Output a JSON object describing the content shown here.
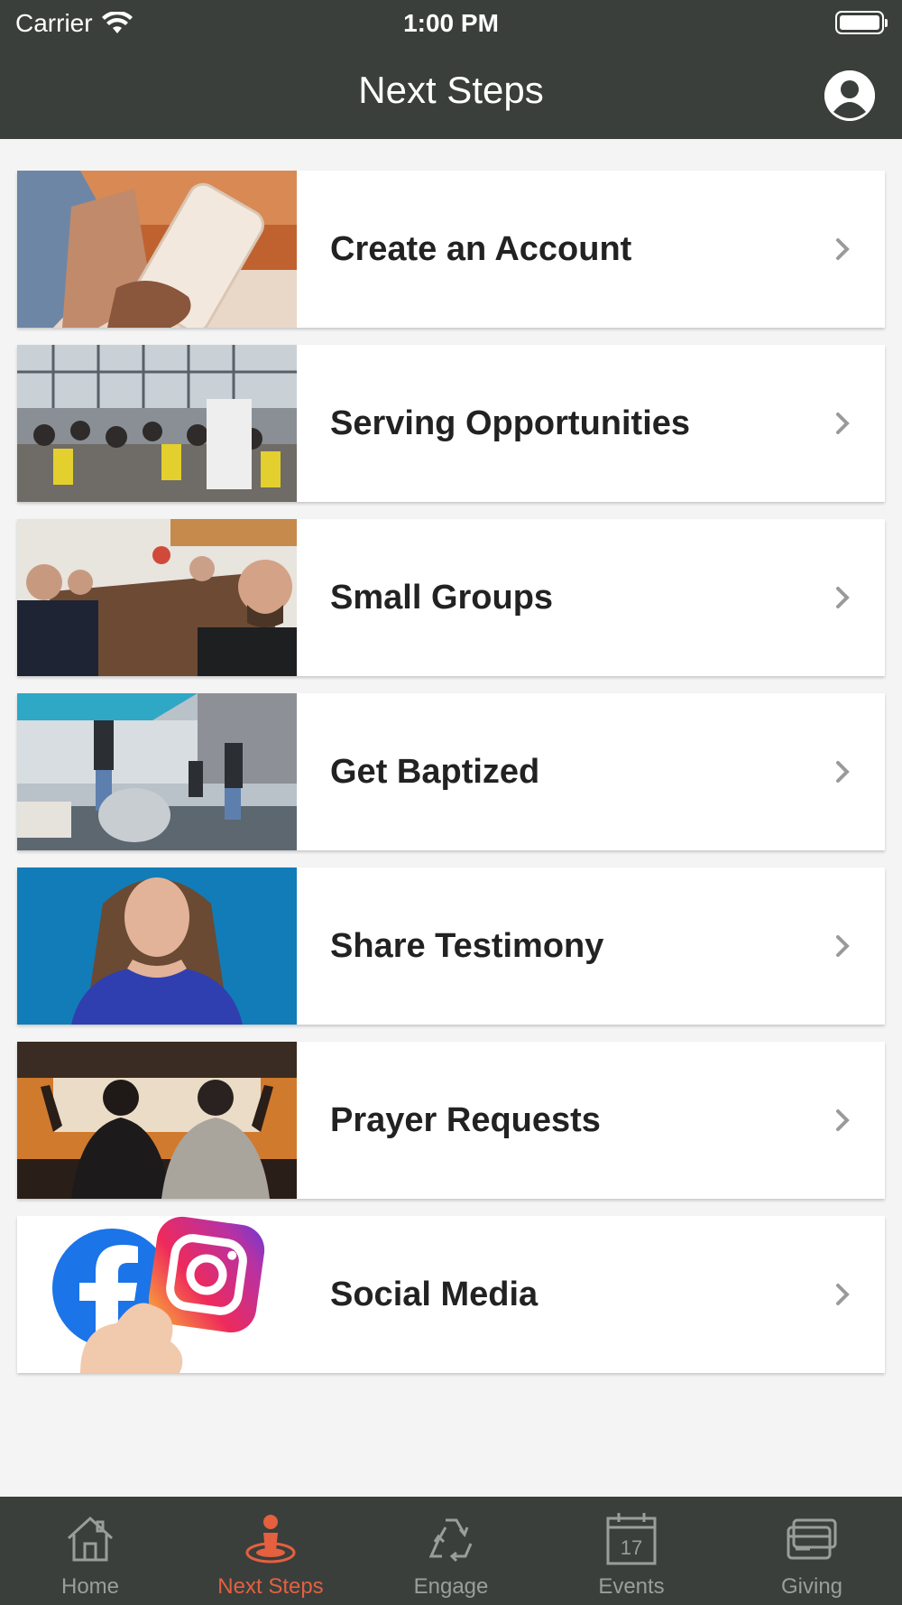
{
  "status_bar": {
    "carrier": "Carrier",
    "time": "1:00 PM"
  },
  "nav": {
    "title": "Next Steps"
  },
  "items": [
    {
      "label": "Create an Account"
    },
    {
      "label": "Serving Opportunities"
    },
    {
      "label": "Small Groups"
    },
    {
      "label": "Get Baptized"
    },
    {
      "label": "Share Testimony"
    },
    {
      "label": "Prayer Requests"
    },
    {
      "label": "Social Media"
    }
  ],
  "tabs": [
    {
      "label": "Home",
      "icon": "home-icon"
    },
    {
      "label": "Next Steps",
      "icon": "next-steps-icon",
      "active": true
    },
    {
      "label": "Engage",
      "icon": "recycle-icon"
    },
    {
      "label": "Events",
      "icon": "calendar-icon",
      "day": "17"
    },
    {
      "label": "Giving",
      "icon": "wallet-icon"
    }
  ],
  "colors": {
    "bar": "#3a3f3c",
    "accent": "#e4603f",
    "inactive": "#9a9e9b",
    "background": "#f4f4f4"
  }
}
